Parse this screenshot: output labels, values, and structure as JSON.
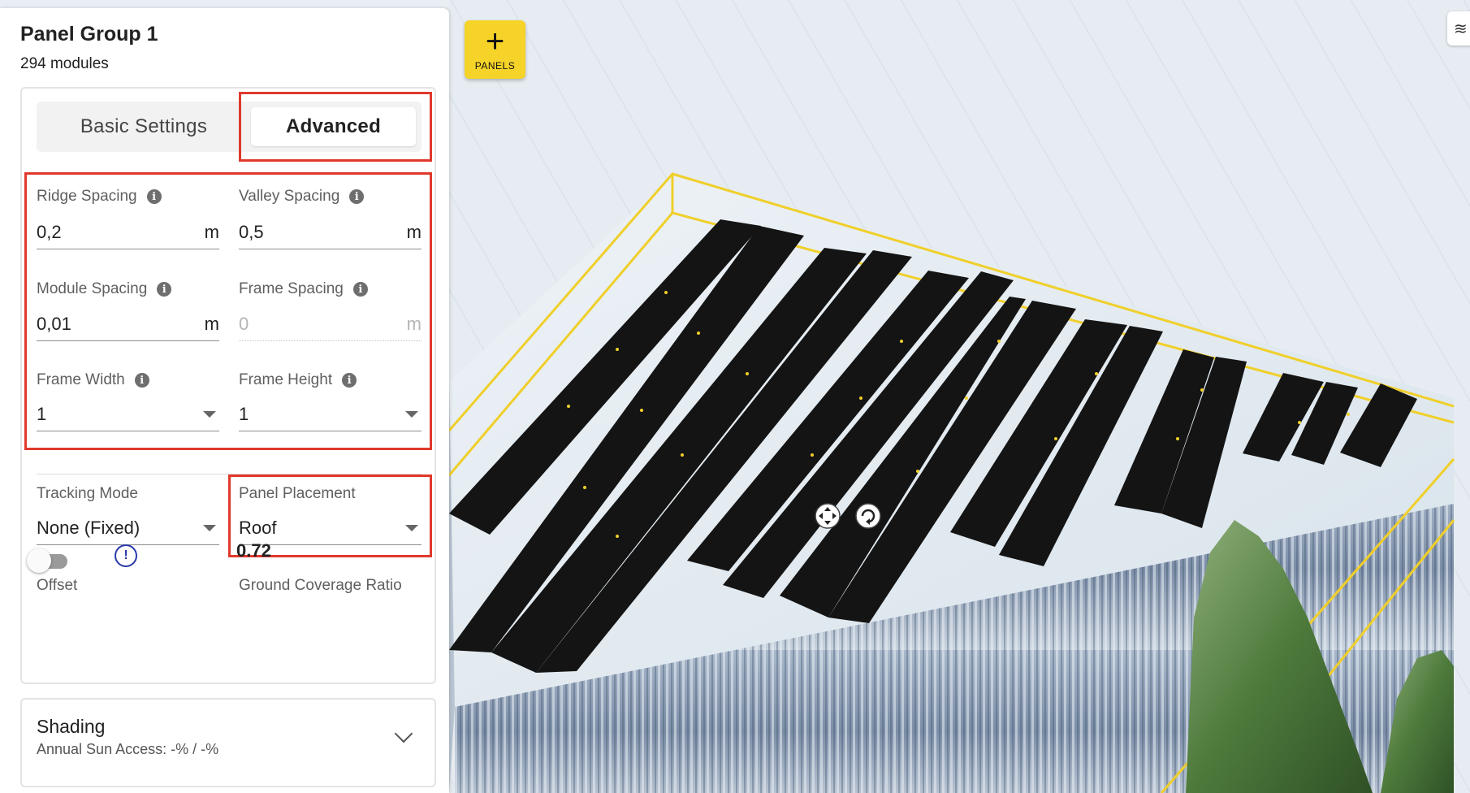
{
  "viewport": {
    "add_panels_label": "PANELS",
    "add_panels_icon": "plus-icon",
    "layers_icon": "layers-icon"
  },
  "panel": {
    "title": "Panel Group 1",
    "module_count": "294 modules",
    "tabs": [
      {
        "label": "Basic Settings",
        "active": false
      },
      {
        "label": "Advanced",
        "active": true
      }
    ],
    "fields": {
      "ridge_spacing": {
        "label": "Ridge Spacing",
        "value": "0,2",
        "unit": "m"
      },
      "valley_spacing": {
        "label": "Valley Spacing",
        "value": "0,5",
        "unit": "m"
      },
      "module_spacing": {
        "label": "Module Spacing",
        "value": "0,01",
        "unit": "m"
      },
      "frame_spacing": {
        "label": "Frame Spacing",
        "value": "0",
        "unit": "m",
        "disabled": true
      },
      "frame_width": {
        "label": "Frame Width",
        "value": "1"
      },
      "frame_height": {
        "label": "Frame Height",
        "value": "1"
      },
      "tracking_mode": {
        "label": "Tracking Mode",
        "value": "None (Fixed)"
      },
      "panel_placement": {
        "label": "Panel Placement",
        "value": "Roof"
      },
      "offset": {
        "label": "Offset",
        "enabled": false
      },
      "ground_coverage_ratio": {
        "label": "Ground Coverage Ratio",
        "value": "0.72"
      }
    },
    "shading": {
      "title": "Shading",
      "subtitle": "Annual Sun Access: -% / -%"
    }
  },
  "colors": {
    "accent_yellow": "#f5d328",
    "highlight_red": "#e0392b",
    "info_blue": "#2b3aa8",
    "panel_black": "#141414"
  }
}
